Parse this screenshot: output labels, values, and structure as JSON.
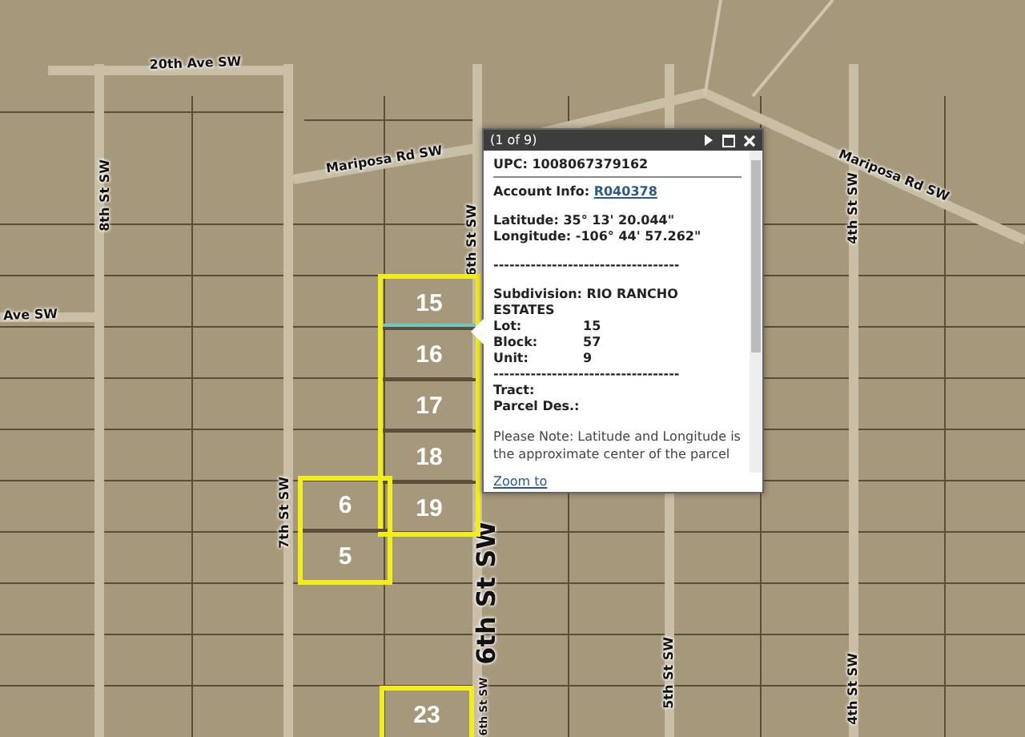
{
  "map": {
    "road_labels": [
      {
        "label": "20th Ave SW",
        "kind": "minor"
      },
      {
        "label": "Mariposa Rd SW",
        "kind": "minor"
      },
      {
        "label": "Mariposa Rd SW",
        "kind": "minor"
      },
      {
        "label": "8th St SW",
        "kind": "minor"
      },
      {
        "label": "Ave SW",
        "kind": "minor"
      },
      {
        "label": "6th St SW",
        "kind": "minor"
      },
      {
        "label": "4th St SW",
        "kind": "minor"
      },
      {
        "label": "7th St SW",
        "kind": "minor"
      },
      {
        "label": "6th St SW",
        "kind": "major"
      },
      {
        "label": "6th St SW",
        "kind": "minor"
      },
      {
        "label": "5th St SW",
        "kind": "minor"
      },
      {
        "label": "4th St SW",
        "kind": "minor"
      }
    ],
    "parcel_groups": [
      {
        "parcels": [
          {
            "label": "15",
            "selected": true
          },
          {
            "label": "16",
            "selected": false
          },
          {
            "label": "17",
            "selected": false
          },
          {
            "label": "18",
            "selected": false
          },
          {
            "label": "19",
            "selected": false
          }
        ]
      },
      {
        "parcels": [
          {
            "label": "6",
            "selected": false
          },
          {
            "label": "5",
            "selected": false
          }
        ]
      },
      {
        "parcels": [
          {
            "label": "23",
            "selected": false
          }
        ]
      }
    ]
  },
  "popup": {
    "title": "(1 of 9)",
    "lines": [
      {
        "kind": "text",
        "text": "UPC: 1008067379162"
      },
      {
        "kind": "rule"
      },
      {
        "kind": "link",
        "text": "Account Info:",
        "link": "R040378"
      },
      {
        "kind": "gap"
      },
      {
        "kind": "text",
        "text": "Latitude: 35° 13' 20.044\""
      },
      {
        "kind": "text",
        "text": "Longitude: -106° 44' 57.262\""
      },
      {
        "kind": "gap"
      },
      {
        "kind": "text",
        "text": "-----------------------------------"
      },
      {
        "kind": "gap"
      },
      {
        "kind": "text",
        "text": "Subdivision: RIO RANCHO ESTATES"
      },
      {
        "kind": "pair",
        "text": "Lot:",
        "value": "15"
      },
      {
        "kind": "pair",
        "text": "Block:",
        "value": "57"
      },
      {
        "kind": "pair",
        "text": "Unit:",
        "value": "9"
      },
      {
        "kind": "text",
        "text": "-----------------------------------"
      },
      {
        "kind": "text",
        "text": "Tract:"
      },
      {
        "kind": "text",
        "text": "Parcel Des.:"
      },
      {
        "kind": "gap"
      },
      {
        "kind": "note",
        "text": "Please Note: Latitude and Longitude is the approximate center of the parcel"
      }
    ],
    "footer_link": "Zoom to"
  }
}
